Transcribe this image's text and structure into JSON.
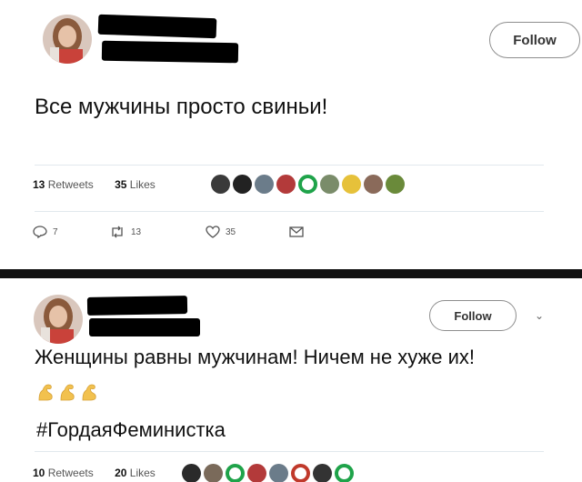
{
  "tweet1": {
    "text": "Все мужчины просто свиньи!",
    "follow_label": "Follow",
    "stats": {
      "retweets_count": "13",
      "retweets_label": "Retweets",
      "likes_count": "35",
      "likes_label": "Likes"
    },
    "actions": {
      "reply_count": "7",
      "retweet_count": "13",
      "like_count": "35"
    }
  },
  "tweet2": {
    "text": "Женщины равны мужчинам! Ничем не хуже их!",
    "hashtag": "#ГордаяФеминистка",
    "follow_label": "Follow",
    "stats": {
      "retweets_count": "10",
      "retweets_label": "Retweets",
      "likes_count": "20",
      "likes_label": "Likes"
    }
  },
  "colors": {
    "separator": "#111111",
    "muscle_emoji": "#f2c14e",
    "face_green": "#1fa34a"
  },
  "icons": [
    "reply-icon",
    "retweet-icon",
    "like-icon",
    "message-icon",
    "chevron-down-icon",
    "muscle-emoji"
  ]
}
